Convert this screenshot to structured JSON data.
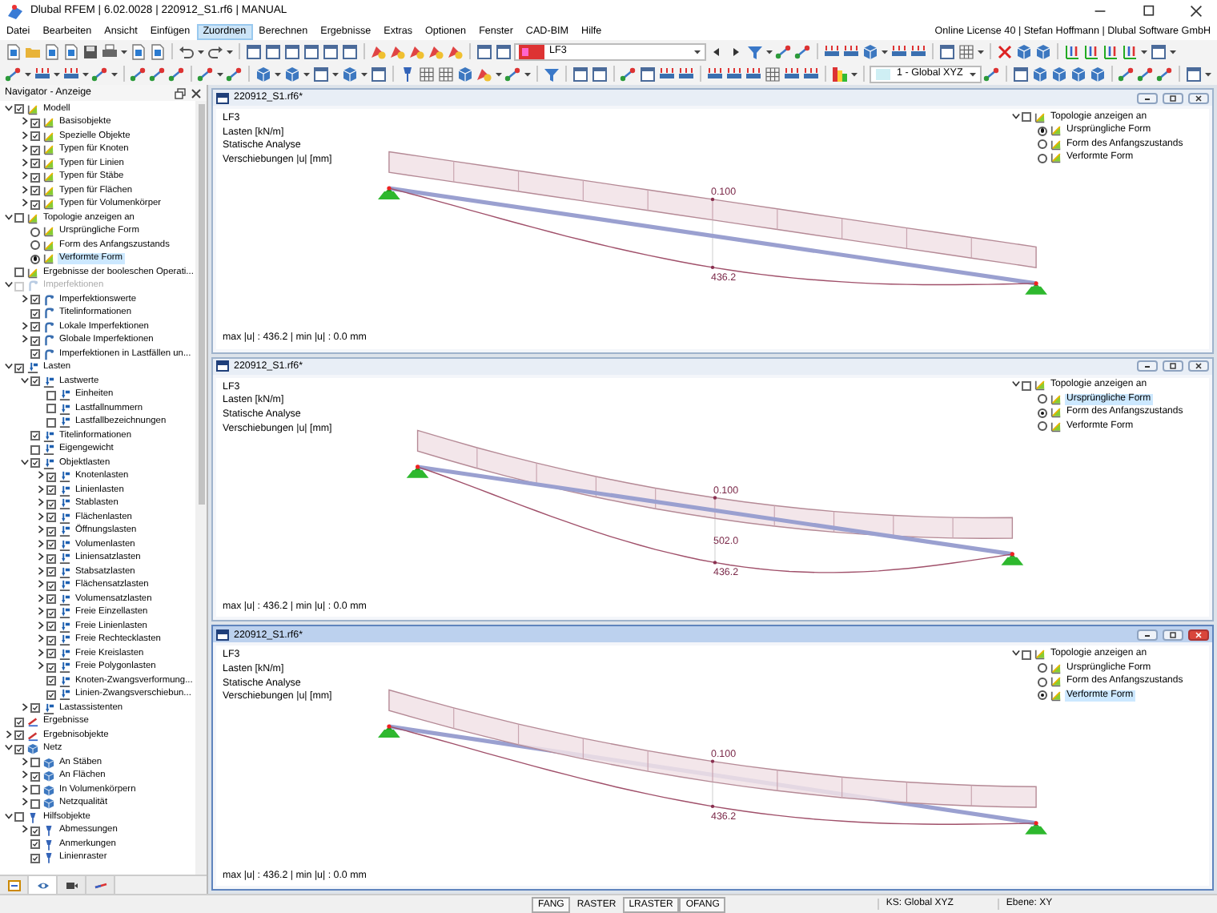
{
  "window": {
    "title": "Dlubal RFEM | 6.02.0028 | 220912_S1.rf6 | MANUAL"
  },
  "menu": [
    {
      "label": "Datei",
      "selected": false
    },
    {
      "label": "Bearbeiten",
      "selected": false
    },
    {
      "label": "Ansicht",
      "selected": false
    },
    {
      "label": "Einfügen",
      "selected": false
    },
    {
      "label": "Zuordnen",
      "selected": true
    },
    {
      "label": "Berechnen",
      "selected": false
    },
    {
      "label": "Ergebnisse",
      "selected": false
    },
    {
      "label": "Extras",
      "selected": false
    },
    {
      "label": "Optionen",
      "selected": false
    },
    {
      "label": "Fenster",
      "selected": false
    },
    {
      "label": "CAD-BIM",
      "selected": false
    },
    {
      "label": "Hilfe",
      "selected": false
    }
  ],
  "license": "Online License 40 | Stefan Hoffmann | Dlubal Software GmbH",
  "toolbar": {
    "load_case": "LF3",
    "coordinate_system": "1 - Global XYZ"
  },
  "navigator": {
    "title": "Navigator - Anzeige",
    "tree": [
      {
        "label": "Modell",
        "kind": "model",
        "checked": true,
        "expanded": true,
        "children": [
          {
            "label": "Basisobjekte",
            "checked": true,
            "expanded": false
          },
          {
            "label": "Spezielle Objekte",
            "checked": true,
            "expanded": false
          },
          {
            "label": "Typen für Knoten",
            "checked": true,
            "expanded": false
          },
          {
            "label": "Typen für Linien",
            "checked": true,
            "expanded": false
          },
          {
            "label": "Typen für Stäbe",
            "checked": true,
            "expanded": false
          },
          {
            "label": "Typen für Flächen",
            "checked": true,
            "expanded": false
          },
          {
            "label": "Typen für Volumenkörper",
            "checked": true,
            "expanded": false
          }
        ]
      },
      {
        "label": "Topologie anzeigen an",
        "kind": "model",
        "checked": false,
        "expanded": true,
        "children": [
          {
            "label": "Ursprüngliche Form",
            "selected": false,
            "highlighted": false
          },
          {
            "label": "Form des Anfangszustands",
            "selected": false,
            "highlighted": false
          },
          {
            "label": "Verformte Form",
            "selected": true,
            "highlighted": true
          }
        ]
      },
      {
        "label": "Ergebnisse der booleschen Operati...",
        "kind": "model",
        "checked": false
      },
      {
        "label": "Imperfektionen",
        "kind": "imperfection",
        "checked": false,
        "disabled": true,
        "expanded": true,
        "children": [
          {
            "label": "Imperfektionswerte",
            "checked": true,
            "expanded": false
          },
          {
            "label": "Titelinformationen",
            "checked": true
          },
          {
            "label": "Lokale Imperfektionen",
            "checked": true,
            "expanded": false
          },
          {
            "label": "Globale Imperfektionen",
            "checked": true,
            "expanded": false
          },
          {
            "label": "Imperfektionen in Lastfällen un...",
            "checked": true
          }
        ]
      },
      {
        "label": "Lasten",
        "kind": "load",
        "checked": true,
        "expanded": true,
        "children": [
          {
            "label": "Lastwerte",
            "checked": true,
            "expanded": true,
            "children": [
              {
                "label": "Einheiten",
                "checked": false
              },
              {
                "label": "Lastfallnummern",
                "checked": false
              },
              {
                "label": "Lastfallbezeichnungen",
                "checked": false
              }
            ]
          },
          {
            "label": "Titelinformationen",
            "checked": true
          },
          {
            "label": "Eigengewicht",
            "checked": false
          },
          {
            "label": "Objektlasten",
            "checked": true,
            "expanded": true,
            "children": [
              {
                "label": "Knotenlasten",
                "checked": true,
                "expanded": false
              },
              {
                "label": "Linienlasten",
                "checked": true,
                "expanded": false
              },
              {
                "label": "Stablasten",
                "checked": true,
                "expanded": false
              },
              {
                "label": "Flächenlasten",
                "checked": true,
                "expanded": false
              },
              {
                "label": "Öffnungslasten",
                "checked": true,
                "expanded": false
              },
              {
                "label": "Volumenlasten",
                "checked": true,
                "expanded": false
              },
              {
                "label": "Liniensatzlasten",
                "checked": true,
                "expanded": false
              },
              {
                "label": "Stabsatzlasten",
                "checked": true,
                "expanded": false
              },
              {
                "label": "Flächensatzlasten",
                "checked": true,
                "expanded": false
              },
              {
                "label": "Volumensatzlasten",
                "checked": true,
                "expanded": false
              },
              {
                "label": "Freie Einzellasten",
                "checked": true,
                "expanded": false
              },
              {
                "label": "Freie Linienlasten",
                "checked": true,
                "expanded": false
              },
              {
                "label": "Freie Rechtecklasten",
                "checked": true,
                "expanded": false
              },
              {
                "label": "Freie Kreislasten",
                "checked": true,
                "expanded": false
              },
              {
                "label": "Freie Polygonlasten",
                "checked": true,
                "expanded": false
              },
              {
                "label": "Knoten-Zwangsverformung...",
                "checked": true
              },
              {
                "label": "Linien-Zwangsverschiebun...",
                "checked": true
              }
            ]
          },
          {
            "label": "Lastassistenten",
            "checked": true,
            "expanded": false
          }
        ]
      },
      {
        "label": "Ergebnisse",
        "kind": "result",
        "checked": true
      },
      {
        "label": "Ergebnisobjekte",
        "kind": "result",
        "checked": true,
        "expanded": false
      },
      {
        "label": "Netz",
        "kind": "mesh",
        "checked": true,
        "expanded": true,
        "children": [
          {
            "label": "An Stäben",
            "checked": false,
            "expanded": false
          },
          {
            "label": "An Flächen",
            "checked": true,
            "expanded": false
          },
          {
            "label": "In Volumenkörpern",
            "checked": false,
            "expanded": false
          },
          {
            "label": "Netzqualität",
            "checked": false,
            "expanded": false
          }
        ]
      },
      {
        "label": "Hilfsobjekte",
        "kind": "guide",
        "checked": false,
        "expanded": true,
        "children": [
          {
            "label": "Abmessungen",
            "checked": true,
            "expanded": false
          },
          {
            "label": "Anmerkungen",
            "checked": true
          },
          {
            "label": "Linienraster",
            "checked": true
          }
        ]
      }
    ],
    "tabs": [
      {
        "kind": "data",
        "selected": false
      },
      {
        "kind": "view",
        "selected": true
      },
      {
        "kind": "camera",
        "selected": false
      },
      {
        "kind": "line",
        "selected": false
      }
    ]
  },
  "views": [
    {
      "title": "220912_S1.rf6*",
      "active": false,
      "kind": "original",
      "info": [
        "LF3",
        "Lasten [kN/m]",
        "Statische Analyse",
        "Verschiebungen |u| [mm]"
      ],
      "footer": "max |u| : 436.2 | min |u| : 0.0 mm",
      "labels": [
        {
          "kind": "load",
          "text": "0.100"
        },
        {
          "kind": "deflection",
          "text": "436.2"
        }
      ],
      "topology": {
        "label": "Topologie anzeigen an",
        "checked": false,
        "expanded": true,
        "options": [
          {
            "label": "Ursprüngliche Form",
            "selected": true,
            "highlighted": false
          },
          {
            "label": "Form des Anfangszustands",
            "selected": false,
            "highlighted": false
          },
          {
            "label": "Verformte Form",
            "selected": false,
            "highlighted": false
          }
        ]
      }
    },
    {
      "title": "220912_S1.rf6*",
      "active": false,
      "kind": "initial",
      "info": [
        "LF3",
        "Lasten [kN/m]",
        "Statische Analyse",
        "Verschiebungen |u| [mm]"
      ],
      "footer": "max |u| : 436.2 | min |u| : 0.0 mm",
      "labels": [
        {
          "kind": "load",
          "text": "0.100"
        },
        {
          "kind": "initial",
          "text": "502.0"
        },
        {
          "kind": "deflection",
          "text": "436.2"
        }
      ],
      "topology": {
        "label": "Topologie anzeigen an",
        "checked": false,
        "expanded": true,
        "options": [
          {
            "label": "Ursprüngliche Form",
            "selected": false,
            "highlighted": true
          },
          {
            "label": "Form des Anfangszustands",
            "selected": true,
            "highlighted": false
          },
          {
            "label": "Verformte Form",
            "selected": false,
            "highlighted": false
          }
        ]
      }
    },
    {
      "title": "220912_S1.rf6*",
      "active": true,
      "kind": "deformed",
      "info": [
        "LF3",
        "Lasten [kN/m]",
        "Statische Analyse",
        "Verschiebungen |u| [mm]"
      ],
      "footer": "max |u| : 436.2 | min |u| : 0.0 mm",
      "labels": [
        {
          "kind": "load",
          "text": "0.100"
        },
        {
          "kind": "deflection",
          "text": "436.2"
        }
      ],
      "topology": {
        "label": "Topologie anzeigen an",
        "checked": false,
        "expanded": true,
        "options": [
          {
            "label": "Ursprüngliche Form",
            "selected": false,
            "highlighted": false
          },
          {
            "label": "Form des Anfangszustands",
            "selected": false,
            "highlighted": false
          },
          {
            "label": "Verformte Form",
            "selected": true,
            "highlighted": true
          }
        ]
      }
    }
  ],
  "status_bar": {
    "toggles": [
      {
        "label": "FANG",
        "on": true
      },
      {
        "label": "RASTER",
        "on": false
      },
      {
        "label": "LRASTER",
        "on": true
      },
      {
        "label": "OFANG",
        "on": true
      }
    ],
    "fields": [
      "KS: Global XYZ",
      "Ebene: XY"
    ]
  }
}
